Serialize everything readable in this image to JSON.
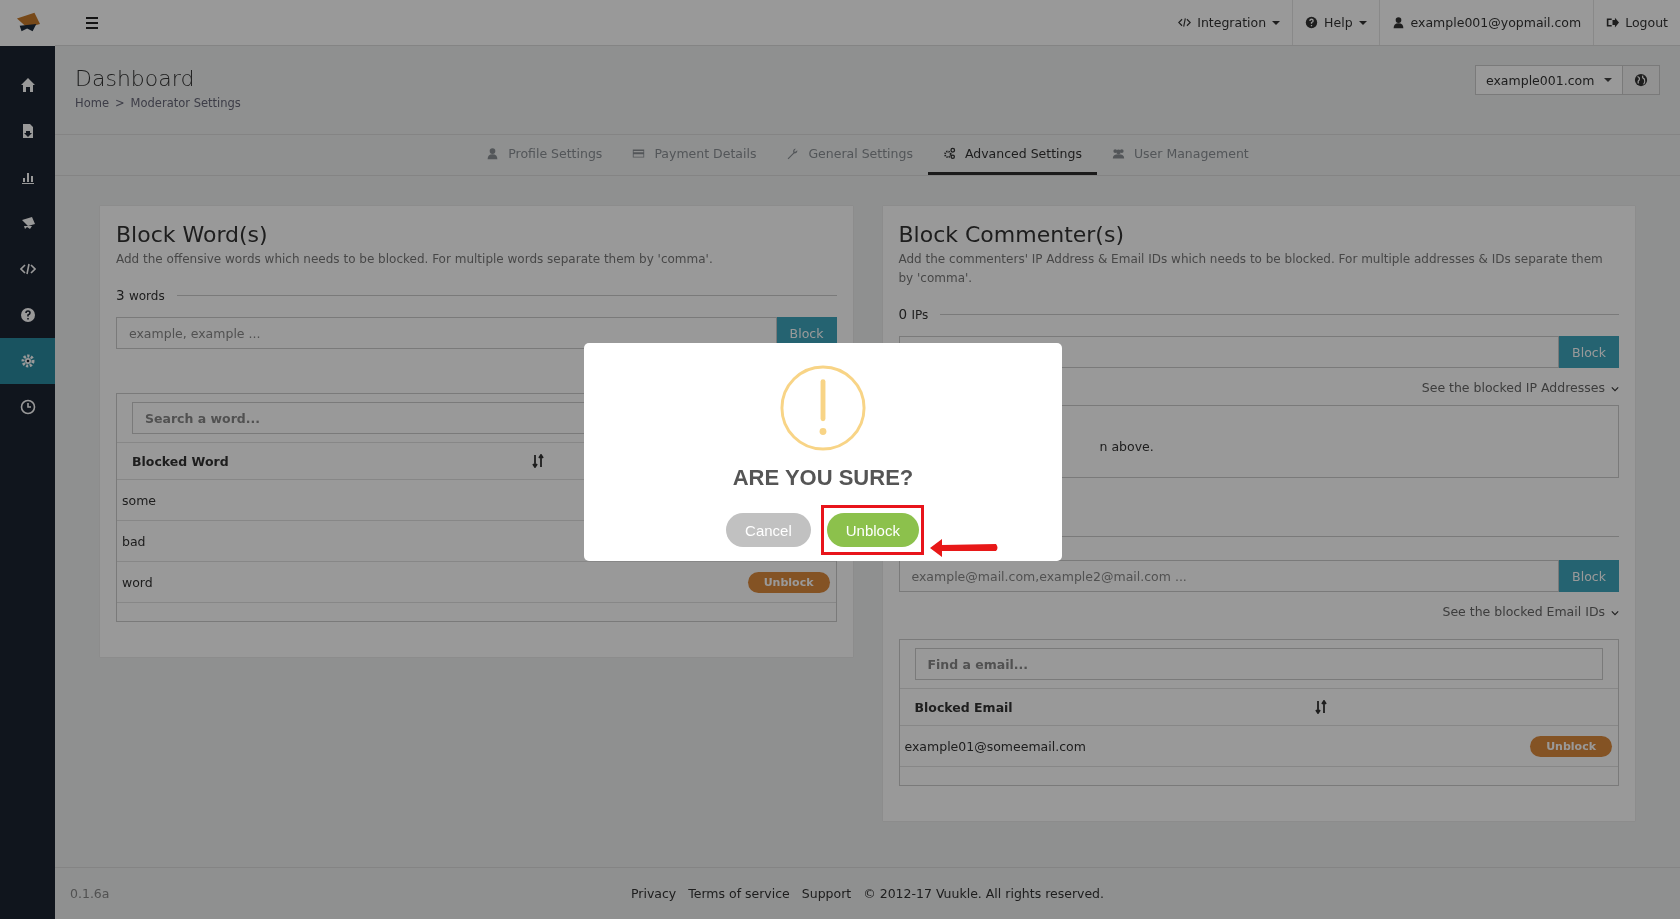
{
  "topbar": {
    "menu": [
      {
        "label": "Integration",
        "kind": "code",
        "dropdown": true
      },
      {
        "label": "Help",
        "kind": "help",
        "dropdown": true
      },
      {
        "label": "example001@yopmail.com",
        "kind": "user",
        "dropdown": false
      },
      {
        "label": "Logout",
        "kind": "logout",
        "dropdown": false
      }
    ]
  },
  "sidebar": {
    "items": [
      {
        "kind": "home",
        "selected": false
      },
      {
        "kind": "import",
        "selected": false
      },
      {
        "kind": "chart",
        "selected": false
      },
      {
        "kind": "chat",
        "selected": false
      },
      {
        "kind": "code",
        "selected": false
      },
      {
        "kind": "help",
        "selected": false
      },
      {
        "kind": "settings",
        "selected": true
      },
      {
        "kind": "clock",
        "selected": false
      }
    ]
  },
  "header": {
    "title": "Dashboard",
    "breadcrumb": [
      "Home",
      ">",
      "Moderator Settings"
    ],
    "site_select": {
      "value": "example001.com"
    }
  },
  "tabs": [
    {
      "label": "Profile Settings",
      "kind": "user",
      "selected": false
    },
    {
      "label": "Payment Details",
      "kind": "card",
      "selected": false
    },
    {
      "label": "General Settings",
      "kind": "wrench",
      "selected": false
    },
    {
      "label": "Advanced Settings",
      "kind": "cogs",
      "selected": true
    },
    {
      "label": "User Management",
      "kind": "users",
      "selected": false
    }
  ],
  "block_words": {
    "title": "Block Word(s)",
    "description": "Add the offensive words which needs to be blocked. For multiple words separate them by 'comma'.",
    "count": "3",
    "count_unit": "words",
    "input": {
      "placeholder": "example, example ...",
      "button": "Block"
    },
    "search": {
      "placeholder": "Search a word..."
    },
    "column": "Blocked Word",
    "rows": [
      {
        "word": "some"
      },
      {
        "word": "bad"
      },
      {
        "word": "word",
        "action": "Unblock"
      }
    ]
  },
  "block_commenters": {
    "title": "Block Commenter(s)",
    "description": "Add the commenters' IP Address & Email IDs which needs to be blocked. For multiple addresses & IDs separate them by 'comma'.",
    "ip_count": "0",
    "ip_unit": "IPs",
    "ip_input": {
      "button": "Block"
    },
    "ip_link": "See the blocked IP Addresses",
    "ip_empty_text": "n above.",
    "email_input": {
      "placeholder": "example@mail.com,example2@mail.com ...",
      "button": "Block"
    },
    "email_link": "See the blocked Email IDs",
    "email_search": {
      "placeholder": "Find a email..."
    },
    "column": "Blocked Email",
    "rows": [
      {
        "email": "example01@someemail.com",
        "action": "Unblock"
      }
    ]
  },
  "footer": {
    "version": "0.1.6a",
    "links": [
      "Privacy",
      "Terms of service",
      "Support"
    ],
    "copyright": "© 2012-17 Vuukle. All rights reserved."
  },
  "dialog": {
    "title": "ARE YOU SURE?",
    "buttons": [
      {
        "label": "Cancel",
        "kind": "cancel",
        "highlighted": false
      },
      {
        "label": "Unblock",
        "kind": "confirm",
        "highlighted": true
      }
    ]
  }
}
